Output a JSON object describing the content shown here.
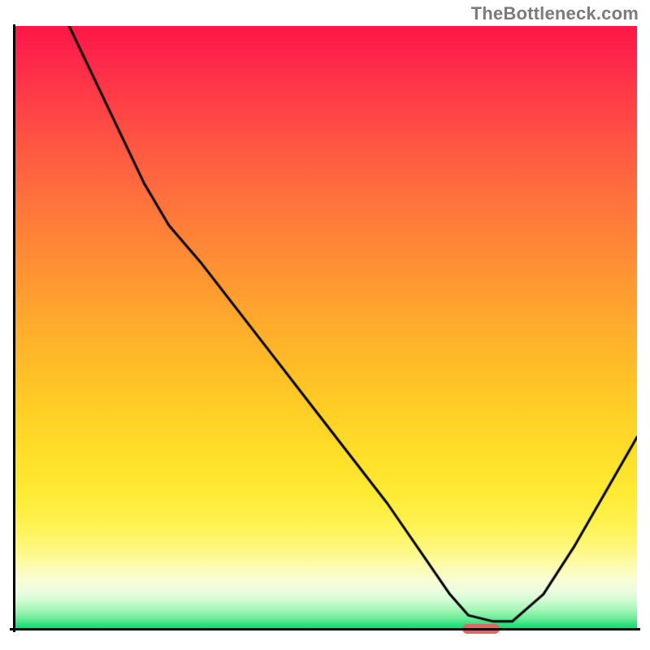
{
  "watermark": "TheBottleneck.com",
  "colors": {
    "curve": "#000000",
    "marker": "#d46a6a",
    "axis": "#000000"
  },
  "chart_data": {
    "type": "line",
    "title": "",
    "xlabel": "",
    "ylabel": "",
    "xlim": [
      0,
      100
    ],
    "ylim": [
      0,
      100
    ],
    "grid": false,
    "series": [
      {
        "name": "bottleneck-curve",
        "x": [
          9,
          15,
          21,
          25,
          30,
          36,
          42,
          48,
          54,
          60,
          66,
          70,
          73,
          77,
          80,
          85,
          90,
          95,
          100
        ],
        "y": [
          100,
          87,
          74,
          67,
          61,
          53,
          45,
          37,
          29,
          21,
          12,
          6,
          2.5,
          1.5,
          1.5,
          6,
          14,
          23,
          32
        ]
      }
    ],
    "marker": {
      "x": 75,
      "width_pct": 6
    }
  }
}
